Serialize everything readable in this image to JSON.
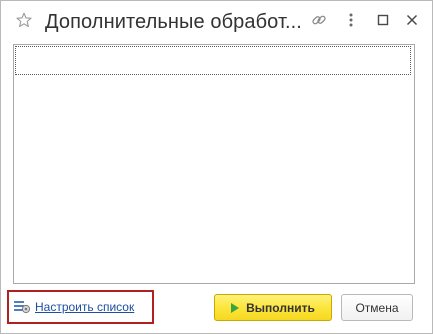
{
  "window": {
    "title": "Дополнительные обработ..."
  },
  "title_bar": {
    "icons": [
      "star-icon",
      "link-icon",
      "more-icon",
      "restore-icon",
      "close-icon"
    ]
  },
  "list": {
    "rows": [
      ""
    ]
  },
  "footer": {
    "config_link_label": "Настроить список",
    "config_icon": "list-settings-icon",
    "run_label": "Выполнить",
    "run_icon": "play-icon",
    "cancel_label": "Отмена"
  },
  "colors": {
    "run_button": "#fce43a",
    "link": "#1c4fa0",
    "highlight_border": "#b21f1f"
  }
}
